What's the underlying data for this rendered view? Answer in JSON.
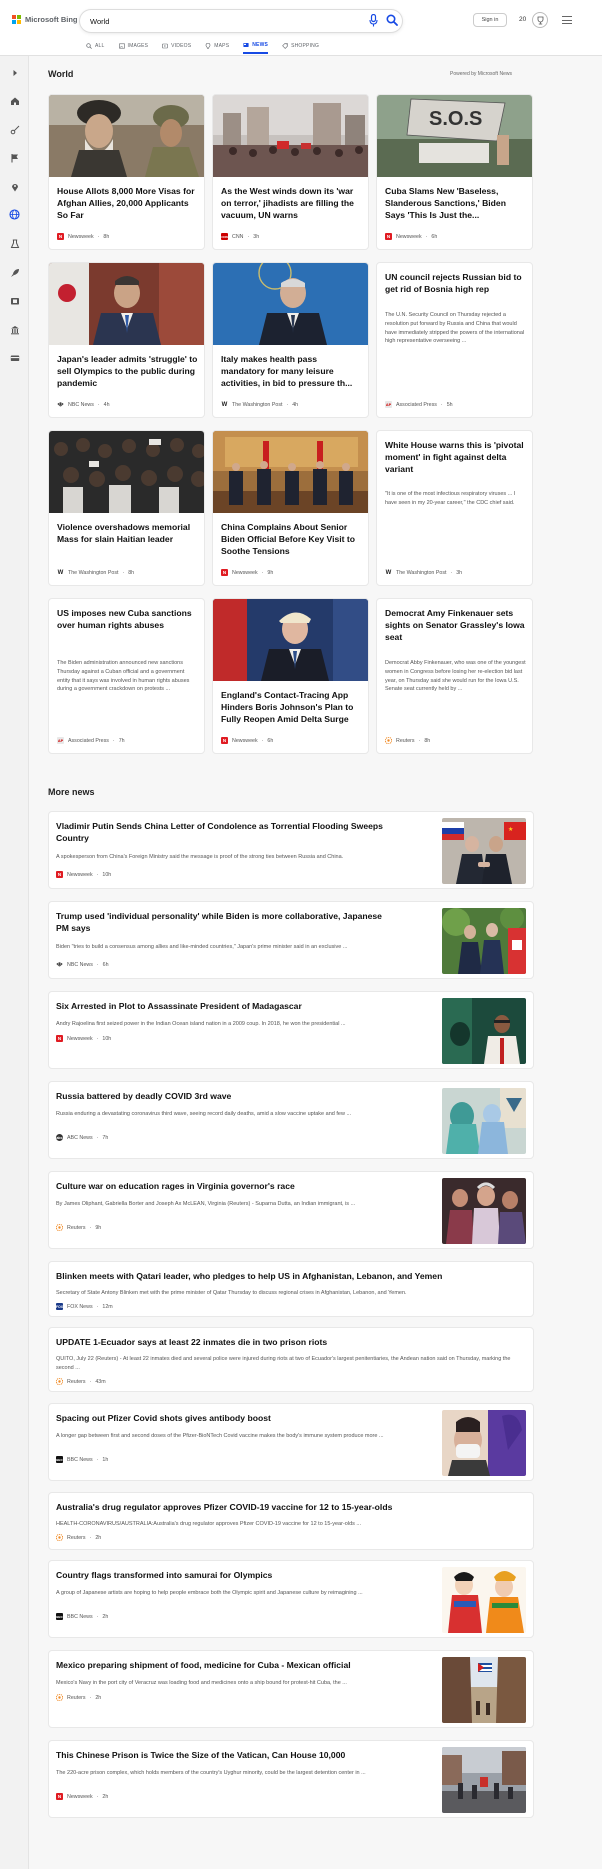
{
  "header": {
    "logo_text": "Microsoft Bing",
    "search_value": "World",
    "signin_label": "Sign in",
    "rewards_count": "20",
    "tabs": [
      {
        "label": "ALL",
        "icon": "search-icon"
      },
      {
        "label": "IMAGES",
        "icon": "image-icon"
      },
      {
        "label": "VIDEOS",
        "icon": "video-icon"
      },
      {
        "label": "MAPS",
        "icon": "map-pin-icon"
      },
      {
        "label": "NEWS",
        "icon": "newspaper-icon"
      },
      {
        "label": "SHOPPING",
        "icon": "shopping-tag-icon"
      }
    ]
  },
  "sidebar": {
    "items": [
      "expand-arrow-icon",
      "home-icon",
      "sports-icon",
      "flag-icon",
      "location-pin-icon",
      "globe-icon",
      "science-icon",
      "rocket-icon",
      "film-icon",
      "bank-icon",
      "money-card-icon"
    ]
  },
  "colors": {
    "accent": "#174ae4",
    "newsweek": "#e01b22",
    "cnn": "#cc0000",
    "reuters": "#f08a24"
  },
  "world": {
    "title": "World",
    "powered_by": "Powered by Microsoft News",
    "cards": [
      {
        "title": "House Allots 8,000 More Visas for Afghan Allies, 20,000 Applicants So Far",
        "snippet": "",
        "source": "Newsweek",
        "time": "8h",
        "logo": "N"
      },
      {
        "title": "As the West winds down its 'war on terror,' jihadists are filling the vacuum, UN warns",
        "snippet": "",
        "source": "CNN",
        "time": "3h",
        "logo": "CNN"
      },
      {
        "title": "Cuba Slams New 'Baseless, Slanderous Sanctions,' Biden Says 'This Is Just the...",
        "snippet": "",
        "source": "Newsweek",
        "time": "6h",
        "logo": "N"
      },
      {
        "title": "Japan's leader admits 'struggle' to sell Olympics to the public during pandemic",
        "snippet": "",
        "source": "NBC News",
        "time": "4h",
        "logo": ""
      },
      {
        "title": "Italy makes health pass mandatory for many leisure activities, in bid to pressure th...",
        "snippet": "",
        "source": "The Washington Post",
        "time": "4h",
        "logo": "W"
      },
      {
        "title": "UN council rejects Russian bid to get rid of Bosnia high rep",
        "snippet": "The U.N. Security Council on Thursday rejected a resolution put forward by Russia and China that would have immediately stripped the powers of the international high representative overseeing ...",
        "source": "Associated Press",
        "time": "5h",
        "logo": "AP"
      },
      {
        "title": "Violence overshadows memorial Mass for slain Haitian leader",
        "snippet": "",
        "source": "The Washington Post",
        "time": "8h",
        "logo": "W"
      },
      {
        "title": "China Complains About Senior Biden Official Before Key Visit to Soothe Tensions",
        "snippet": "",
        "source": "Newsweek",
        "time": "9h",
        "logo": "N"
      },
      {
        "title": "White House warns this is 'pivotal moment' in fight against delta variant",
        "snippet": "\"It is one of the most infectious respiratory viruses ... I have seen in my 20-year career,\" the CDC chief said.",
        "source": "The Washington Post",
        "time": "3h",
        "logo": "W"
      },
      {
        "title": "US imposes new Cuba sanctions over human rights abuses",
        "snippet": "The Biden administration announced new sanctions Thursday against a Cuban official and a government entity that it says was involved in human rights abuses during a government crackdown on protests ...",
        "source": "Associated Press",
        "time": "7h",
        "logo": "AP"
      },
      {
        "title": "England's Contact-Tracing App Hinders Boris Johnson's Plan to Fully Reopen Amid Delta Surge",
        "snippet": "",
        "source": "Newsweek",
        "time": "6h",
        "logo": "N"
      },
      {
        "title": "Democrat Amy Finkenauer sets sights on Senator Grassley's Iowa seat",
        "snippet": "Democrat Abby Finkenauer, who was one of the youngest women in Congress before losing her re-election bid last year, on Thursday said she would run for the Iowa U.S. Senate seat currently held by ...",
        "source": "Reuters",
        "time": "8h",
        "logo": ""
      }
    ]
  },
  "more_news": {
    "title": "More news",
    "items": [
      {
        "title": "Vladimir Putin Sends China Letter of Condolence as Torrential Flooding Sweeps Country",
        "snippet": "A spokesperson from China's Foreign Ministry said the message is proof of the strong ties between Russia and China.",
        "source": "Newsweek",
        "time": "10h",
        "logo": "N"
      },
      {
        "title": "Trump used 'individual personality' while Biden is more collaborative, Japanese PM says",
        "snippet": "Biden \"tries to build a consensus among allies and like-minded countries,\" Japan's prime minister said in an exclusive ...",
        "source": "NBC News",
        "time": "6h",
        "logo": ""
      },
      {
        "title": "Six Arrested in Plot to Assassinate President of Madagascar",
        "snippet": "Andry Rajoelina first seized power in the Indian Ocean island nation in a 2009 coup. In 2018, he won the presidential ...",
        "source": "Newsweek",
        "time": "10h",
        "logo": "N"
      },
      {
        "title": "Russia battered by deadly COVID 3rd wave",
        "snippet": "Russia enduring a devastating coronavirus third wave, seeing record daily deaths, amid a slow vaccine uptake and few ...",
        "source": "ABC News",
        "time": "7h",
        "logo": "abc"
      },
      {
        "title": "Culture war on education rages in Virginia governor's race",
        "snippet": "By James Oliphant, Gabriella Borter and Joseph Ax McLEAN, Virginia (Reuters) - Suparna Dutta, an Indian immigrant, is ...",
        "source": "Reuters",
        "time": "9h",
        "logo": ""
      },
      {
        "title": "Blinken meets with Qatari leader, who pledges to help US in Afghanistan, Lebanon, and Yemen",
        "snippet": "Secretary of State Antony Blinken met with the prime minister of Qatar Thursday to discuss regional crises in Afghanistan, Lebanon, and Yemen.",
        "source": "FOX News",
        "time": "12m",
        "logo": "FOX"
      },
      {
        "title": "UPDATE 1-Ecuador says at least 22 inmates die in two prison riots",
        "snippet": "QUITO, July 22 (Reuters) - At least 22 inmates died and several police were injured during riots at two of Ecuador's largest penitentiaries, the Andean nation said on Thursday, marking the second ...",
        "source": "Reuters",
        "time": "43m",
        "logo": ""
      },
      {
        "title": "Spacing out Pfizer Covid shots gives antibody boost",
        "snippet": "A longer gap between first and second doses of the Pfizer-BioNTech Covid vaccine makes the body's immune system produce more ...",
        "source": "BBC News",
        "time": "1h",
        "logo": "BBC"
      },
      {
        "title": "Australia's drug regulator approves Pfizer COVID-19 vaccine for 12 to 15-year-olds",
        "snippet": "HEALTH-CORONAVIRUS/AUSTRALIA:Australia's drug regulator approves Pfizer COVID-19 vaccine for 12 to 15-year-olds ...",
        "source": "Reuters",
        "time": "2h",
        "logo": ""
      },
      {
        "title": "Country flags transformed into samurai for Olympics",
        "snippet": "A group of Japanese artists are hoping to help people embrace both the Olympic spirit and Japanese culture by reimagining ...",
        "source": "BBC News",
        "time": "2h",
        "logo": "BBC"
      },
      {
        "title": "Mexico preparing shipment of food, medicine for Cuba - Mexican official",
        "snippet": "Mexico's Navy in the port city of Veracruz was loading food and medicines onto a ship bound for protest-hit Cuba, the ...",
        "source": "Reuters",
        "time": "2h",
        "logo": ""
      },
      {
        "title": "This Chinese Prison is Twice the Size of the Vatican, Can House 10,000",
        "snippet": "The 220-acre prison complex, which holds members of the country's Uyghur minority, could be the largest detention center in ...",
        "source": "Newsweek",
        "time": "2h",
        "logo": "N"
      }
    ]
  }
}
